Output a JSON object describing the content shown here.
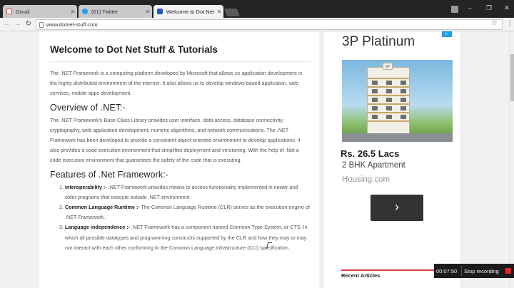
{
  "tabs": [
    {
      "label": "Gmail",
      "icon": "google-icon",
      "color": "#ffffff",
      "active": false
    },
    {
      "label": "(61) Twitter",
      "icon": "twitter-icon",
      "color": "#1da1f2",
      "active": false
    },
    {
      "label": "Welcome to Dot Net Stu",
      "icon": "dotnetstuff-icon",
      "color": "#2457b8",
      "active": true
    }
  ],
  "toolbar": {
    "url": "www.dotnet-stuff.com"
  },
  "article": {
    "title": "Welcome to Dot Net Stuff & Tutorials",
    "intro": "The .NET Framework is a computing platform developed by Microsoft that allows us application development in the highly distributed environment of the internet. It also allows us to develop windows based application, web services, mobile apps development.",
    "overview_heading": "Overview of .NET:-",
    "overview_text": "The .NET Framework's Base Class Library provides user interface, data access, database connectivity, cryptography, web application development, numeric algorithms, and network communications. The .NET Framework has been developed to provide a consistent object-oriented environment to develop applications. It also provides a code execution environment that simplifies deployment and versioning. With the help of .Net a code execution environment that guarantees the safety of the code that is executing.",
    "features_heading": "Features of .Net Framework:-",
    "features": [
      {
        "term": "Interoperability :-",
        "text": " .NET Framework provides means to access functionality implemented in newer and older programs that execute outside .NET environment"
      },
      {
        "term": "Common Language Runtime :-",
        "text": " The Common Language Runtime (CLR) serves as the execution engine of .NET Framework."
      },
      {
        "term": "Language independence :-",
        "text": " .NET Framework has a component named Common Type System, or CTS. In which all possible datatypes and programming constructs supported by the CLR and how they may or may not interact with each other conforming to the Common Language Infrastructure (CLI) specification."
      }
    ]
  },
  "ad": {
    "title": "3P Platinum",
    "price": "Rs. 26.5 Lacs",
    "subtitle": "2 BHK Apartment",
    "domain": "Housing.com",
    "building_sign": "3P",
    "button_glyph": "›"
  },
  "sidebar": {
    "recent_heading": "Recent Articles"
  },
  "recording": {
    "time": "00:07:50",
    "stop_label": "Stop recording"
  }
}
